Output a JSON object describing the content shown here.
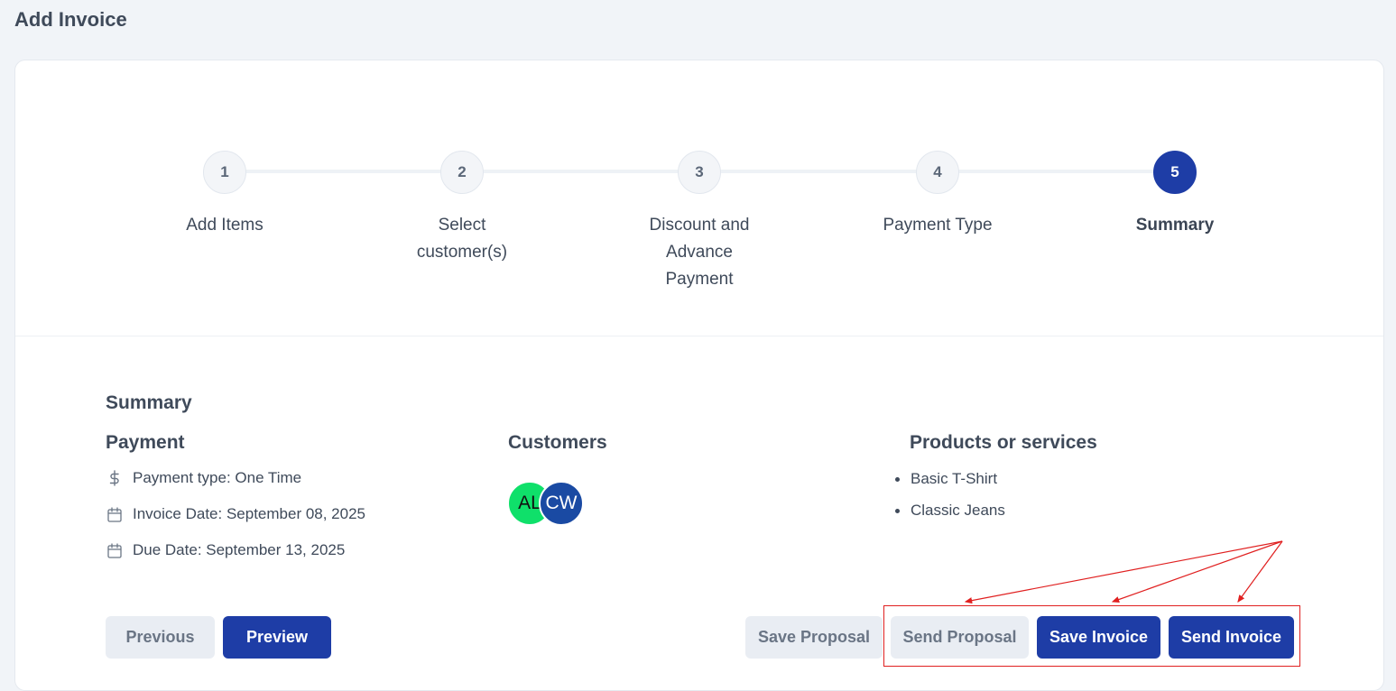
{
  "page": {
    "title": "Add Invoice"
  },
  "stepper": {
    "steps": [
      {
        "number": "1",
        "label": "Add Items",
        "active": false
      },
      {
        "number": "2",
        "label": "Select customer(s)",
        "active": false
      },
      {
        "number": "3",
        "label": "Discount and Advance Payment",
        "active": false
      },
      {
        "number": "4",
        "label": "Payment Type",
        "active": false
      },
      {
        "number": "5",
        "label": "Summary",
        "active": true
      }
    ]
  },
  "summary": {
    "title": "Summary",
    "payment": {
      "title": "Payment",
      "payment_type": "Payment type: One Time",
      "invoice_date": "Invoice Date: September 08, 2025",
      "due_date": "Due Date: September 13, 2025"
    },
    "customers": {
      "title": "Customers",
      "avatars": [
        {
          "initials": "AL",
          "color": "#0fe06a"
        },
        {
          "initials": "CW",
          "color": "#1a4aa3"
        }
      ]
    },
    "products": {
      "title": "Products or services",
      "items": [
        "Basic T-Shirt",
        "Classic Jeans"
      ]
    }
  },
  "actions": {
    "previous": "Previous",
    "preview": "Preview",
    "save_proposal": "Save Proposal",
    "send_proposal": "Send Proposal",
    "save_invoice": "Save Invoice",
    "send_invoice": "Send Invoice"
  },
  "colors": {
    "primary": "#1e3da6",
    "secondary_bg": "#e9edf3",
    "annotation": "#e02020"
  },
  "icons": {
    "payment_type": "dollar-icon",
    "invoice_date": "calendar-icon",
    "due_date": "calendar-icon"
  }
}
